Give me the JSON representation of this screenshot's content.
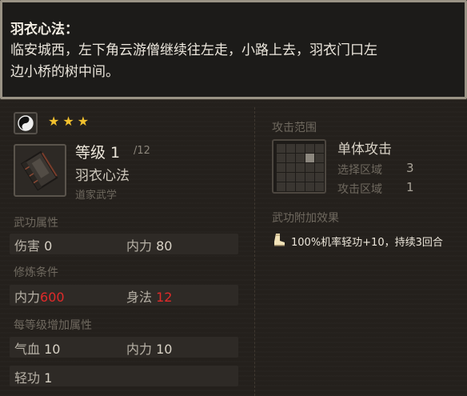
{
  "tooltip": {
    "title": "羽衣心法：",
    "line1": "临安城西，左下角云游僧继续往左走，小路上去，羽衣门口左",
    "line2": "边小桥的树中间。"
  },
  "skill": {
    "stars": 3,
    "icon": "yin-yang-icon",
    "book_icon": "book-icon",
    "level": "等级 1",
    "max_level": "/12",
    "name": "羽衣心法",
    "type": "道家武学"
  },
  "attributes": {
    "title": "武功属性",
    "damage_label": "伤害",
    "damage_value": "0",
    "neili_label": "内力",
    "neili_value": "80"
  },
  "requirements": {
    "title": "修炼条件",
    "neili_label": "内力",
    "neili_value": "600",
    "shenfa_label": "身法",
    "shenfa_value": "12"
  },
  "per_level": {
    "title": "每等级增加属性",
    "qixue_label": "气血",
    "qixue_value": "10",
    "neili_label": "内力",
    "neili_value": "10",
    "qinggong_label": "轻功",
    "qinggong_value": "1"
  },
  "attack": {
    "range_title": "攻击范围",
    "type": "单体攻击",
    "select_label": "选择区域",
    "select_value": "3",
    "attack_label": "攻击区域",
    "attack_value": "1"
  },
  "effects": {
    "title": "武功附加效果",
    "icon": "boot-icon",
    "text": "100%机率轻功+10，持续3回合"
  },
  "colors": {
    "star": "#f2c12e",
    "requirement_unmet": "#e02a2a"
  }
}
